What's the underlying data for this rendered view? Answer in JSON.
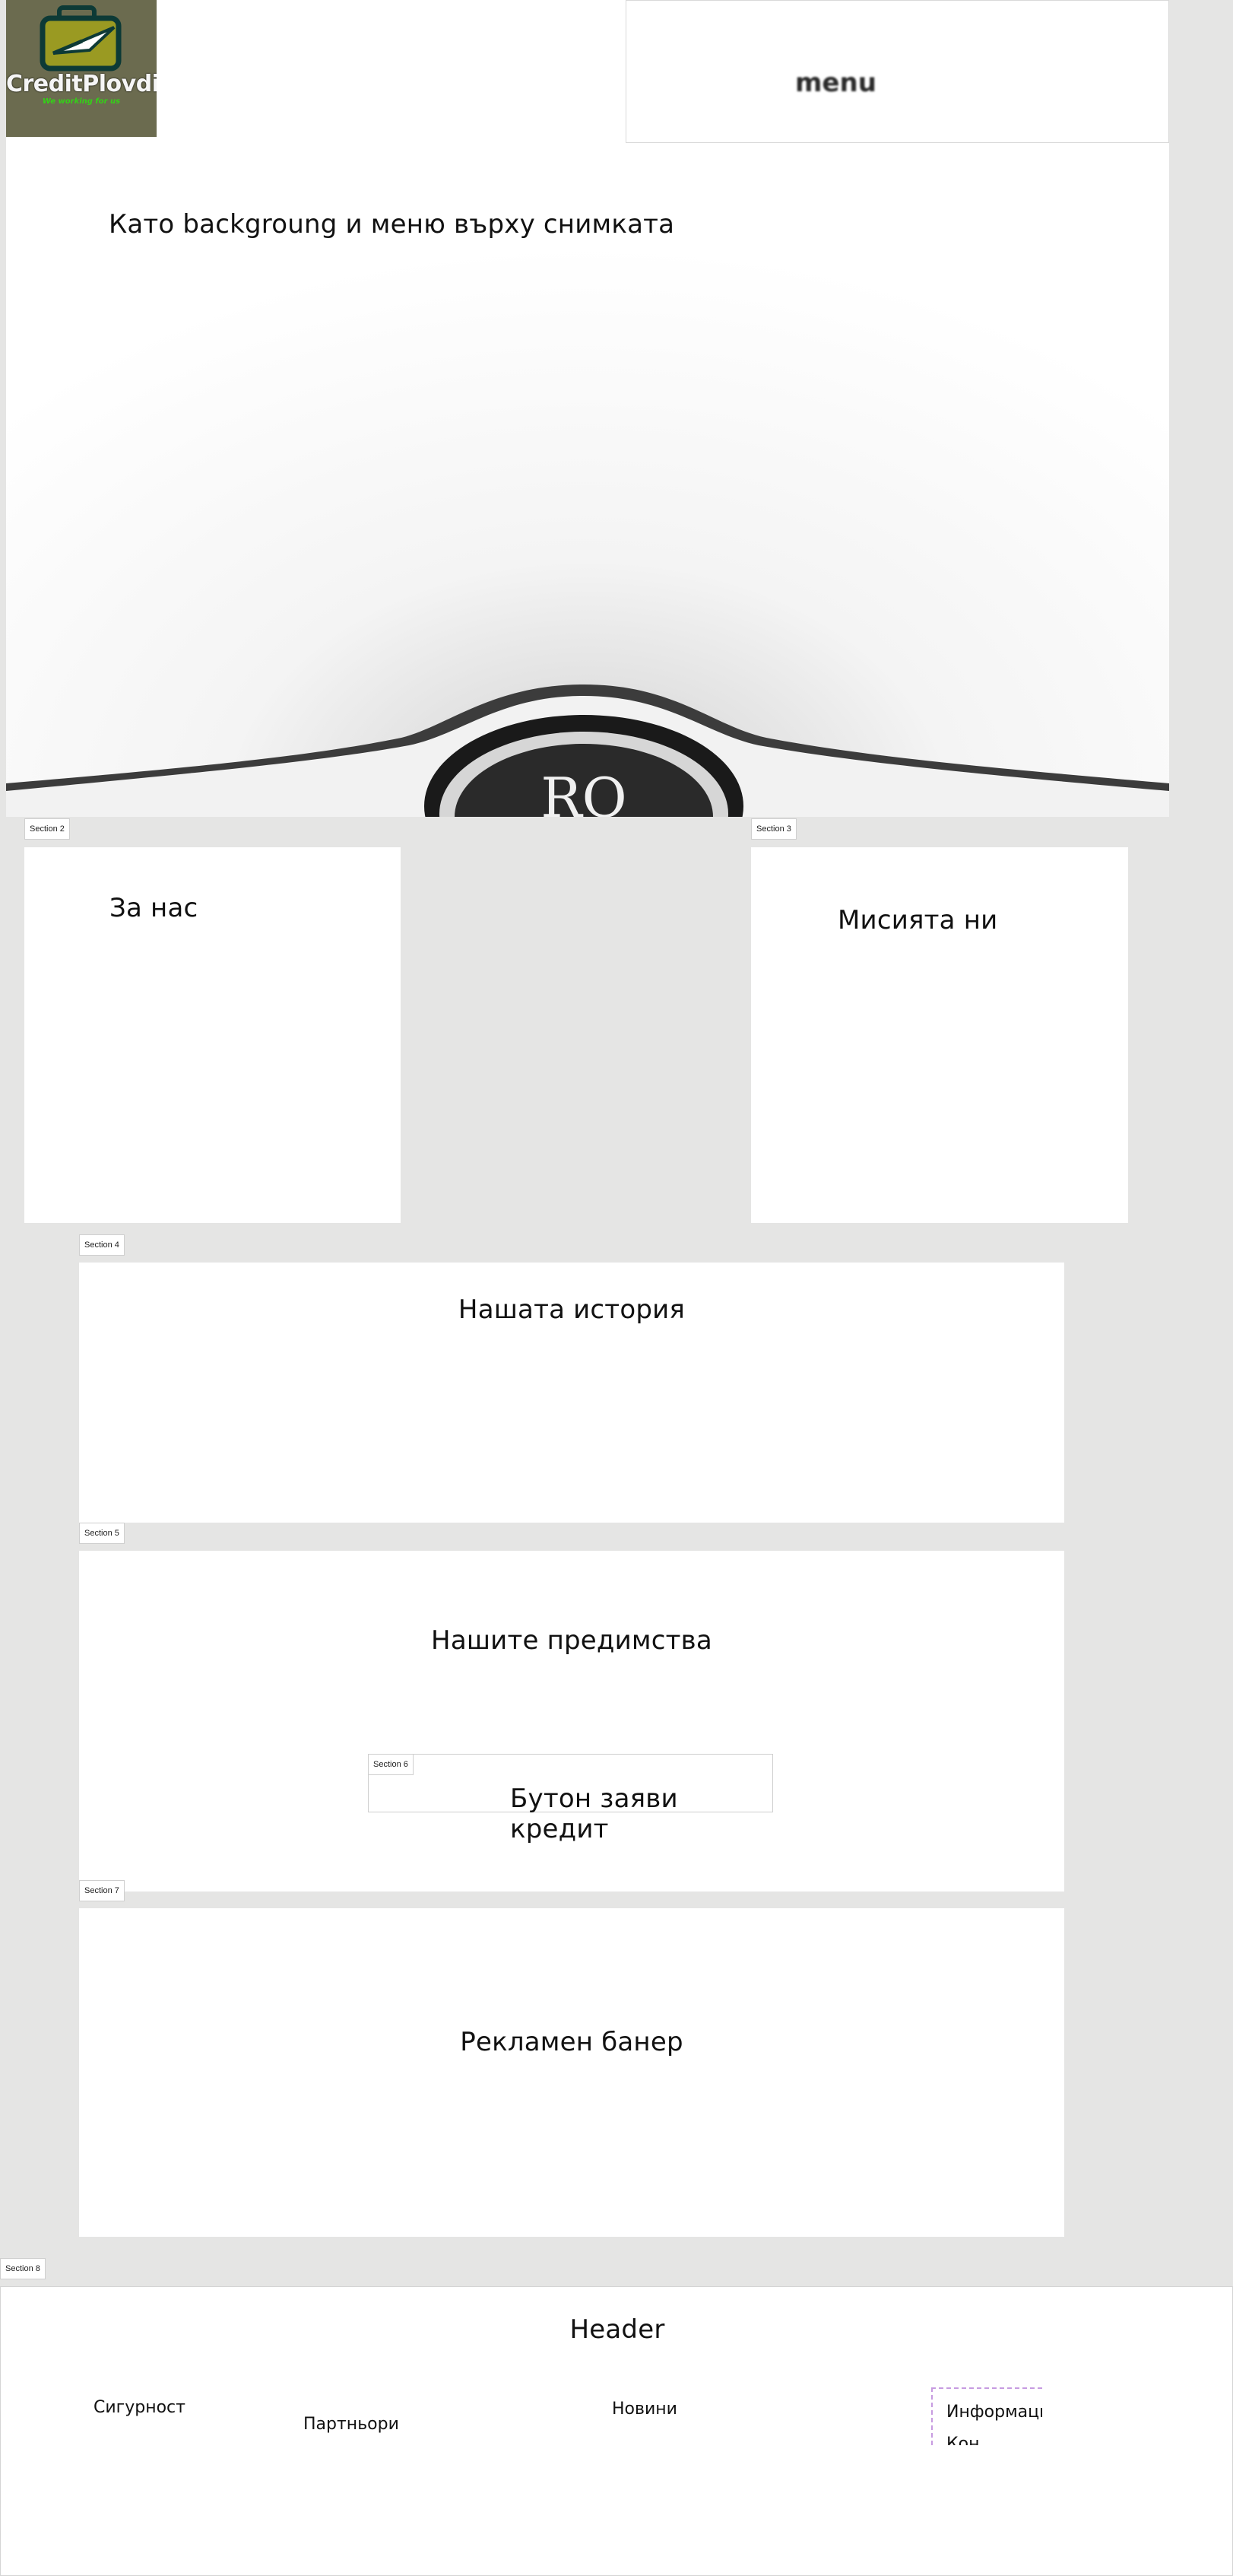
{
  "logo": {
    "title": "CreditPlovdiv",
    "tagline": "We working for us",
    "colors": {
      "bg": "#6b6b4f",
      "accent": "#34d018",
      "case": "#9a9a22"
    }
  },
  "menu": {
    "label": "menu"
  },
  "hero": {
    "text": "Като backgroung и меню върху снимката",
    "emblem_text": "RO"
  },
  "sections": {
    "s2": {
      "tab": "Section 2",
      "title": "За нас"
    },
    "s3": {
      "tab": "Section 3",
      "title": "Мисията ни"
    },
    "s4": {
      "tab": "Section 4",
      "title": "Нашата история"
    },
    "s5": {
      "tab": "Section 5",
      "title": "Нашите предимства"
    },
    "s6": {
      "tab": "Section 6",
      "title": "Бутон заяви кредит"
    },
    "s7": {
      "tab": "Section 7",
      "title": "Рекламен банер"
    },
    "s8": {
      "tab": "Section 8"
    }
  },
  "footer": {
    "title": "Header",
    "links": [
      "Сигурност",
      "Партньори",
      "Новини",
      "Информация",
      "Кон"
    ]
  }
}
